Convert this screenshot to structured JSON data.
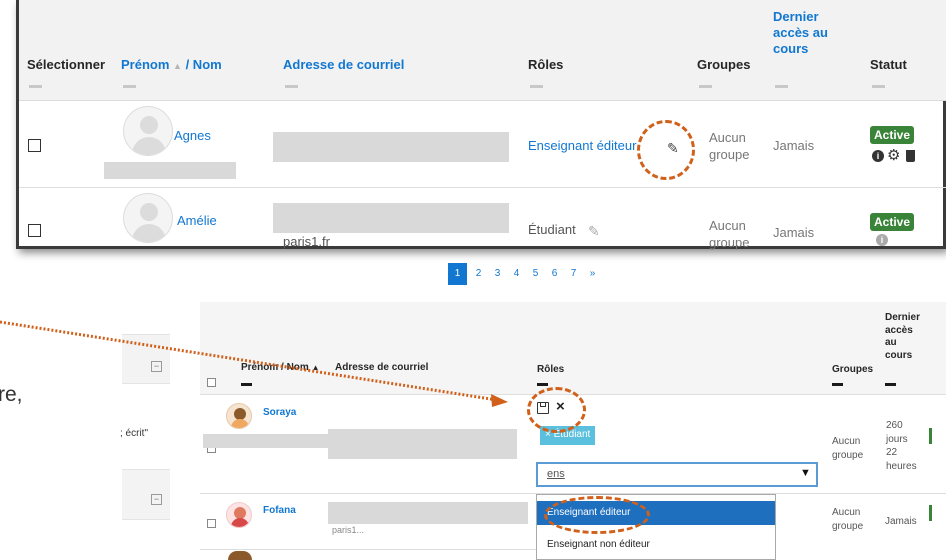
{
  "top_table": {
    "headers": {
      "select": "Sélectionner",
      "firstname": "Prénom",
      "sort_arrow": "▲",
      "lastname": "/ Nom",
      "email": "Adresse de courriel",
      "roles": "Rôles",
      "groups": "Groupes",
      "last_access_1": "Dernier",
      "last_access_2": "accès au",
      "last_access_3": "cours",
      "status": "Statut"
    },
    "rows": [
      {
        "name": "Agnes",
        "role": "Enseignant éditeur",
        "group_1": "Aucun",
        "group_2": "groupe",
        "access": "Jamais",
        "status": "Active"
      },
      {
        "name": "Amélie",
        "email_domain": "paris1.fr",
        "role": "Étudiant",
        "group_1": "Aucun",
        "group_2": "groupe",
        "access": "Jamais",
        "status": "Active"
      }
    ]
  },
  "pagination": [
    "1",
    "2",
    "3",
    "4",
    "5",
    "6",
    "7",
    "»"
  ],
  "bottom_table": {
    "headers": {
      "name": "Prénom / Nom",
      "sort_arrow": "▲",
      "email": "Adresse de courriel",
      "roles": "Rôles",
      "groups": "Groupes",
      "last_access_1": "Dernier",
      "last_access_2": "accès",
      "last_access_3": "au",
      "last_access_4": "cours"
    },
    "rows": [
      {
        "name": "Soraya",
        "role_tag": "× Étudiant",
        "group_1": "Aucun",
        "group_2": "groupe",
        "access_1": "260",
        "access_2": "jours",
        "access_3": "22",
        "access_4": "heures"
      },
      {
        "name": "Fofana",
        "email_domain": "paris1...",
        "group_1": "Aucun",
        "group_2": "groupe",
        "access": "Jamais"
      }
    ],
    "role_search": {
      "value": "ens",
      "dropdown_arrow": "▼"
    },
    "role_options": [
      "Enseignant éditeur",
      "Enseignant non éditeur"
    ]
  },
  "left_fragments": {
    "text_re": "re,",
    "text_ecrit": "; écrit\""
  },
  "icons": {
    "pencil": "pencil-icon",
    "save": "save-icon",
    "close": "close-icon",
    "info": "info-icon",
    "gear": "gear-icon",
    "trash": "trash-icon",
    "collapse": "collapse-icon"
  },
  "colors": {
    "link": "#1177d1",
    "active_badge": "#398439",
    "annotation": "#d0601a",
    "role_tag": "#5bc0de",
    "selected_option": "#1f6fbf"
  }
}
